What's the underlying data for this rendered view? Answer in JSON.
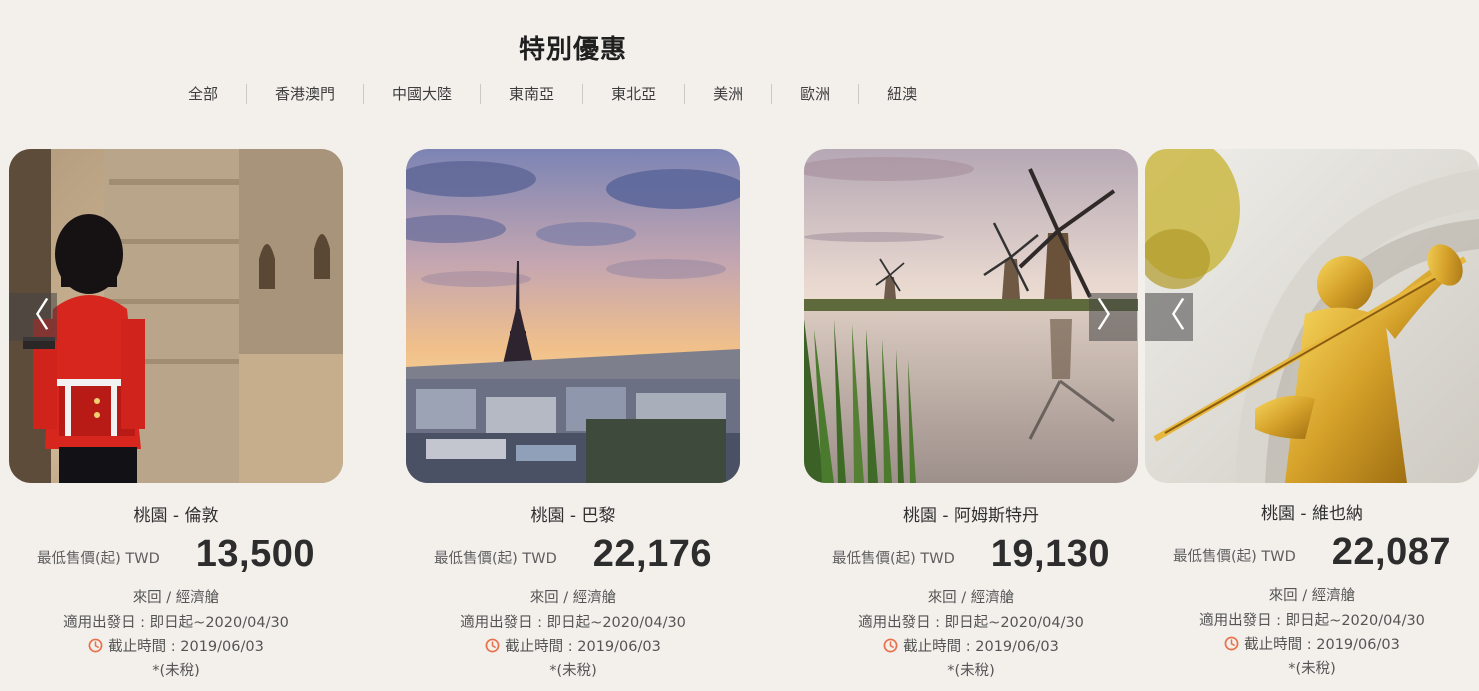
{
  "section": {
    "title": "特別優惠"
  },
  "tabs": [
    {
      "label": "全部"
    },
    {
      "label": "香港澳門"
    },
    {
      "label": "中國大陸"
    },
    {
      "label": "東南亞"
    },
    {
      "label": "東北亞"
    },
    {
      "label": "美洲"
    },
    {
      "label": "歐洲"
    },
    {
      "label": "紐澳"
    }
  ],
  "cards": [
    {
      "route": "桃園 - 倫敦",
      "price_prefix": "最低售價(起) TWD",
      "price": "13,500",
      "trip": "來回 / 經濟艙",
      "period": "適用出發日 : 即日起~2020/04/30",
      "deadline": "截止時間 : 2019/06/03",
      "tax": "*(未稅)",
      "image_icon": "london-guard-photo"
    },
    {
      "route": "桃園 - 巴黎",
      "price_prefix": "最低售價(起) TWD",
      "price": "22,176",
      "trip": "來回 / 經濟艙",
      "period": "適用出發日 : 即日起~2020/04/30",
      "deadline": "截止時間 : 2019/06/03",
      "tax": "*(未稅)",
      "image_icon": "paris-eiffel-tower-photo"
    },
    {
      "route": "桃園 - 阿姆斯特丹",
      "price_prefix": "最低售價(起) TWD",
      "price": "19,130",
      "trip": "來回 / 經濟艙",
      "period": "適用出發日 : 即日起~2020/04/30",
      "deadline": "截止時間 : 2019/06/03",
      "tax": "*(未稅)",
      "image_icon": "amsterdam-windmills-photo"
    },
    {
      "route": "桃園 - 維也納",
      "price_prefix": "最低售價(起) TWD",
      "price": "22,087",
      "trip": "來回 / 經濟艙",
      "period": "適用出發日 : 即日起~2020/04/30",
      "deadline": "截止時間 : 2019/06/03",
      "tax": "*(未稅)",
      "image_icon": "vienna-golden-statue-photo"
    }
  ],
  "carousel": {
    "prev_glyph": "〈",
    "next_glyph": "〉"
  },
  "colors": {
    "background": "#f3f0ec",
    "clock_icon": "#e8704a",
    "text": "#3a3a3a"
  }
}
